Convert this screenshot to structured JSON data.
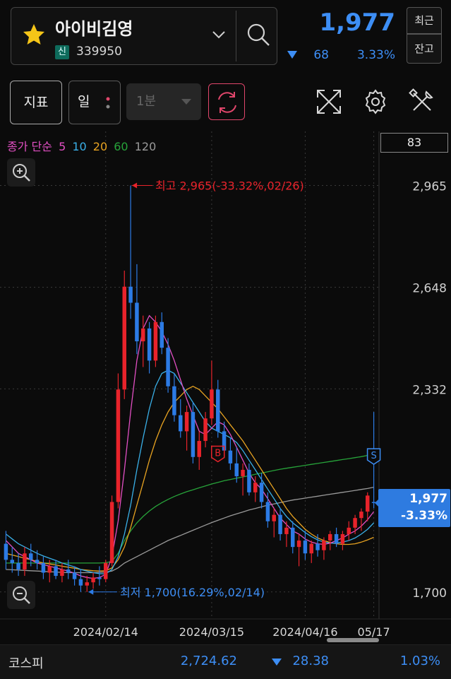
{
  "header": {
    "stock_name": "아이비김영",
    "credit_badge": "신",
    "stock_code": "339950",
    "price": "1,977",
    "change_value": "68",
    "change_pct": "3.33%",
    "btn_recent": "최근",
    "btn_balance": "잔고"
  },
  "toolbar": {
    "indicator_label": "지표",
    "period_label": "일",
    "interval_label": "1분"
  },
  "legend": {
    "ma_type": "종가 단순",
    "periods": [
      "5",
      "10",
      "20",
      "60",
      "120"
    ],
    "colors": [
      "#e24fc3",
      "#3ab0e8",
      "#e8a321",
      "#27a33a",
      "#9a9a9a"
    ]
  },
  "volume_box": "83",
  "price_badge": {
    "price": "1,977",
    "pct": "-3.33%"
  },
  "colors": {
    "up": "#e8232b",
    "down": "#2c7be5",
    "accent": "#3d8ef5"
  },
  "chart_data": {
    "type": "candlestick",
    "y_ticks": [
      "2,965",
      "2,648",
      "2,332",
      "1,700"
    ],
    "y_tick_values": [
      2965,
      2648,
      2332,
      1700
    ],
    "ylim": [
      1660,
      3010
    ],
    "x_labels": [
      "2024/02/14",
      "2024/03/15",
      "2024/04/16",
      "05/17"
    ],
    "grid": true,
    "high_annotation": "최고 2,965(-33.32%,02/26)",
    "low_annotation": "최저 1,700(16.29%,02/14)",
    "markers": [
      {
        "label": "B"
      },
      {
        "label": "S"
      }
    ],
    "last_price": 1977,
    "candles": [
      [
        1850,
        1890,
        1770,
        1800
      ],
      [
        1800,
        1840,
        1760,
        1790
      ],
      [
        1790,
        1820,
        1750,
        1770
      ],
      [
        1770,
        1840,
        1750,
        1820
      ],
      [
        1820,
        1850,
        1780,
        1800
      ],
      [
        1800,
        1830,
        1770,
        1790
      ],
      [
        1790,
        1810,
        1740,
        1760
      ],
      [
        1760,
        1800,
        1730,
        1780
      ],
      [
        1780,
        1800,
        1740,
        1750
      ],
      [
        1750,
        1790,
        1730,
        1770
      ],
      [
        1770,
        1800,
        1740,
        1760
      ],
      [
        1760,
        1780,
        1720,
        1740
      ],
      [
        1740,
        1770,
        1700,
        1720
      ],
      [
        1720,
        1750,
        1700,
        1730
      ],
      [
        1730,
        1760,
        1710,
        1745
      ],
      [
        1745,
        1780,
        1720,
        1740
      ],
      [
        1740,
        1800,
        1730,
        1790
      ],
      [
        1790,
        2000,
        1780,
        1980
      ],
      [
        1980,
        2380,
        1960,
        2330
      ],
      [
        2330,
        2700,
        2300,
        2650
      ],
      [
        2650,
        2965,
        2550,
        2600
      ],
      [
        2600,
        2720,
        2440,
        2480
      ],
      [
        2480,
        2560,
        2400,
        2520
      ],
      [
        2520,
        2540,
        2380,
        2420
      ],
      [
        2420,
        2560,
        2400,
        2540
      ],
      [
        2540,
        2570,
        2440,
        2460
      ],
      [
        2460,
        2490,
        2320,
        2340
      ],
      [
        2340,
        2380,
        2230,
        2250
      ],
      [
        2250,
        2300,
        2180,
        2200
      ],
      [
        2200,
        2280,
        2140,
        2260
      ],
      [
        2260,
        2290,
        2100,
        2120
      ],
      [
        2120,
        2200,
        2080,
        2170
      ],
      [
        2170,
        2260,
        2150,
        2240
      ],
      [
        2240,
        2420,
        2220,
        2330
      ],
      [
        2330,
        2360,
        2180,
        2200
      ],
      [
        2200,
        2230,
        2120,
        2140
      ],
      [
        2140,
        2180,
        2080,
        2100
      ],
      [
        2100,
        2150,
        2040,
        2060
      ],
      [
        2060,
        2100,
        2000,
        2080
      ],
      [
        2080,
        2100,
        2000,
        2010
      ],
      [
        2010,
        2060,
        1980,
        2040
      ],
      [
        2040,
        2070,
        1960,
        1980
      ],
      [
        1980,
        2010,
        1900,
        1920
      ],
      [
        1920,
        1960,
        1870,
        1940
      ],
      [
        1940,
        1960,
        1860,
        1880
      ],
      [
        1880,
        1920,
        1840,
        1900
      ],
      [
        1900,
        1920,
        1820,
        1840
      ],
      [
        1840,
        1880,
        1780,
        1860
      ],
      [
        1860,
        1890,
        1800,
        1820
      ],
      [
        1820,
        1860,
        1790,
        1850
      ],
      [
        1850,
        1880,
        1810,
        1830
      ],
      [
        1830,
        1870,
        1800,
        1860
      ],
      [
        1860,
        1890,
        1830,
        1880
      ],
      [
        1880,
        1900,
        1840,
        1850
      ],
      [
        1850,
        1890,
        1830,
        1880
      ],
      [
        1880,
        1920,
        1860,
        1900
      ],
      [
        1900,
        1940,
        1880,
        1930
      ],
      [
        1930,
        1960,
        1890,
        1950
      ],
      [
        1950,
        2010,
        1920,
        2000
      ],
      [
        1980,
        2260,
        1960,
        1977
      ]
    ],
    "ma5": [
      1860,
      1840,
      1820,
      1810,
      1800,
      1790,
      1785,
      1780,
      1775,
      1770,
      1765,
      1758,
      1750,
      1745,
      1742,
      1745,
      1755,
      1810,
      1920,
      2080,
      2260,
      2420,
      2520,
      2560,
      2540,
      2510,
      2470,
      2420,
      2360,
      2300,
      2250,
      2200,
      2190,
      2210,
      2230,
      2220,
      2190,
      2150,
      2110,
      2070,
      2040,
      2020,
      1990,
      1960,
      1930,
      1910,
      1890,
      1880,
      1865,
      1855,
      1850,
      1848,
      1852,
      1860,
      1868,
      1880,
      1890,
      1905,
      1925,
      1950
    ],
    "ma10": [
      1880,
      1865,
      1850,
      1840,
      1830,
      1820,
      1812,
      1805,
      1798,
      1790,
      1784,
      1778,
      1770,
      1765,
      1760,
      1757,
      1756,
      1770,
      1810,
      1880,
      1970,
      2080,
      2180,
      2270,
      2340,
      2380,
      2390,
      2380,
      2350,
      2320,
      2290,
      2260,
      2230,
      2210,
      2200,
      2190,
      2180,
      2165,
      2140,
      2110,
      2080,
      2050,
      2020,
      1990,
      1960,
      1935,
      1915,
      1900,
      1885,
      1872,
      1862,
      1855,
      1852,
      1852,
      1855,
      1860,
      1868,
      1880,
      1895,
      1915
    ],
    "ma20": [
      1820,
      1815,
      1810,
      1805,
      1800,
      1795,
      1790,
      1787,
      1784,
      1780,
      1777,
      1774,
      1770,
      1768,
      1766,
      1765,
      1766,
      1775,
      1800,
      1840,
      1900,
      1970,
      2040,
      2110,
      2170,
      2220,
      2260,
      2290,
      2310,
      2330,
      2340,
      2330,
      2310,
      2290,
      2270,
      2245,
      2220,
      2195,
      2170,
      2140,
      2110,
      2080,
      2050,
      2020,
      1990,
      1960,
      1935,
      1915,
      1895,
      1880,
      1868,
      1860,
      1854,
      1850,
      1848,
      1848,
      1850,
      1855,
      1862,
      1870
    ],
    "ma60": [
      1790,
      1790,
      1790,
      1790,
      1790,
      1790,
      1790,
      1790,
      1790,
      1790,
      1790,
      1790,
      1790,
      1790,
      1790,
      1790,
      1791,
      1795,
      1820,
      1860,
      1890,
      1915,
      1935,
      1952,
      1966,
      1978,
      1988,
      1997,
      2005,
      2012,
      2018,
      2024,
      2030,
      2036,
      2041,
      2046,
      2050,
      2054,
      2058,
      2062,
      2066,
      2070,
      2074,
      2078,
      2082,
      2085,
      2088,
      2091,
      2094,
      2097,
      2100,
      2103,
      2106,
      2109,
      2112,
      2115,
      2118,
      2121,
      2125,
      2130
    ],
    "ma120": [
      1770,
      1769,
      1768,
      1767,
      1766,
      1765,
      1764,
      1763,
      1762,
      1761,
      1760,
      1760,
      1760,
      1760,
      1760,
      1761,
      1762,
      1765,
      1775,
      1790,
      1800,
      1810,
      1820,
      1830,
      1840,
      1850,
      1860,
      1868,
      1876,
      1884,
      1892,
      1900,
      1908,
      1916,
      1923,
      1930,
      1937,
      1943,
      1949,
      1955,
      1960,
      1965,
      1970,
      1974,
      1978,
      1982,
      1986,
      1989,
      1992,
      1995,
      1998,
      2001,
      2004,
      2007,
      2010,
      2013,
      2016,
      2019,
      2022,
      2026
    ]
  },
  "footer": {
    "index_name": "코스피",
    "index_value": "2,724.62",
    "index_change": "28.38",
    "index_pct": "1.03%"
  }
}
